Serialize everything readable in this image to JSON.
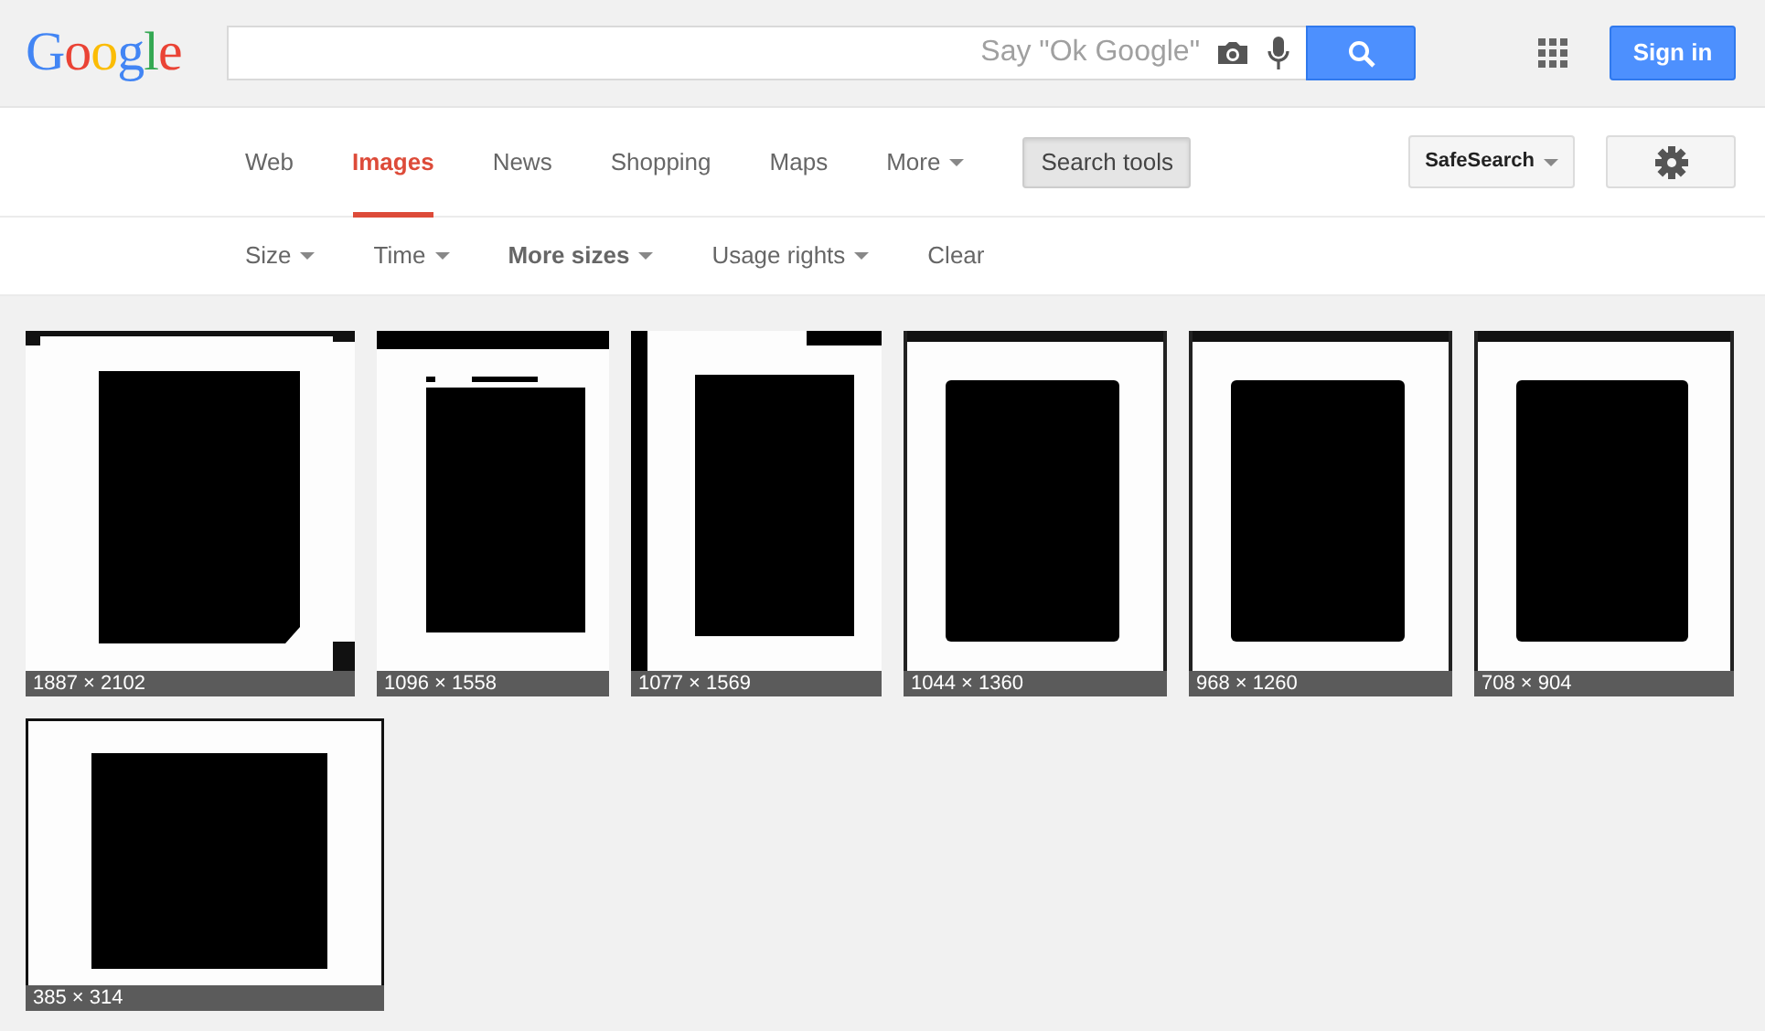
{
  "logo": "Google",
  "search": {
    "placeholder": "Say \"Ok Google\""
  },
  "sign_in": "Sign in",
  "tabs": [
    {
      "label": "Web",
      "selected": false,
      "kind": "link"
    },
    {
      "label": "Images",
      "selected": true,
      "kind": "link"
    },
    {
      "label": "News",
      "selected": false,
      "kind": "link"
    },
    {
      "label": "Shopping",
      "selected": false,
      "kind": "link"
    },
    {
      "label": "Maps",
      "selected": false,
      "kind": "link"
    },
    {
      "label": "More",
      "selected": false,
      "kind": "dropdown"
    }
  ],
  "search_tools": {
    "label": "Search tools",
    "pressed": true
  },
  "safesearch": "SafeSearch",
  "filters": [
    {
      "label": "Size",
      "kind": "dropdown",
      "active": false
    },
    {
      "label": "Time",
      "kind": "dropdown",
      "active": false
    },
    {
      "label": "More sizes",
      "kind": "dropdown",
      "active": true
    },
    {
      "label": "Usage rights",
      "kind": "dropdown",
      "active": false
    },
    {
      "label": "Clear",
      "kind": "link",
      "active": false
    }
  ],
  "results": [
    {
      "kind": "picture",
      "caption": "1887 × 2102"
    },
    {
      "kind": "picture",
      "caption": "1096 × 1558"
    },
    {
      "kind": "picture",
      "caption": "1077 × 1569"
    },
    {
      "kind": "picture",
      "caption": "1044 × 1360"
    },
    {
      "kind": "picture",
      "caption": "968 × 1260"
    },
    {
      "kind": "picture",
      "caption": "708 × 904"
    },
    {
      "kind": "picture",
      "caption": "385 × 314"
    }
  ]
}
